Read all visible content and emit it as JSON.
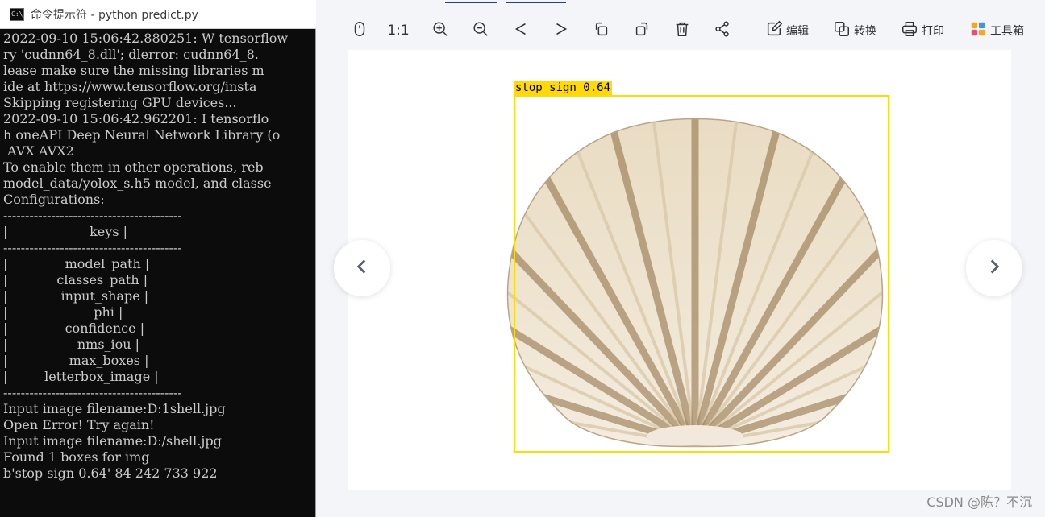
{
  "terminal": {
    "title": "命令提示符 - python  predict.py",
    "icon_text": "C:\\_",
    "lines": [
      "2022-09-10 15:06:42.880251: W tensorflow",
      "ry 'cudnn64_8.dll'; dlerror: cudnn64_8.",
      "lease make sure the missing libraries m",
      "ide at https://www.tensorflow.org/insta",
      "Skipping registering GPU devices...",
      "2022-09-10 15:06:42.962201: I tensorflo",
      "h oneAPI Deep Neural Network Library (o",
      " AVX AVX2",
      "To enable them in other operations, reb",
      "model_data/yolox_s.h5 model, and classe",
      "Configurations:",
      "-----------------------------------------",
      "|                    keys |",
      "-----------------------------------------",
      "|              model_path |",
      "|            classes_path |",
      "|             input_shape |",
      "|                     phi |",
      "|              confidence |",
      "|                 nms_iou |",
      "|               max_boxes |",
      "|         letterbox_image |",
      "-----------------------------------------",
      "Input image filename:D:1shell.jpg",
      "Open Error! Try again!",
      "Input image filename:D:/shell.jpg",
      "Found 1 boxes for img",
      "b'stop sign 0.64' 84 242 733 922"
    ]
  },
  "viewer": {
    "toolbar": {
      "ratio_label": "1:1",
      "edit_label": "编辑",
      "convert_label": "转换",
      "print_label": "打印",
      "tools_label": "工具箱"
    },
    "icons": {
      "mouse": "mouse-icon",
      "zoom_in": "zoom-in-icon",
      "zoom_out": "zoom-out-icon",
      "prev": "chevron-left-icon",
      "next": "chevron-right-icon",
      "rotate_left": "rotate-left-icon",
      "rotate_right": "rotate-right-icon",
      "delete": "trash-icon",
      "share": "share-icon"
    },
    "detection": {
      "label": "stop sign 0.64",
      "color": "#ffd90a"
    },
    "watermark": "CSDN @陈？不沉"
  }
}
